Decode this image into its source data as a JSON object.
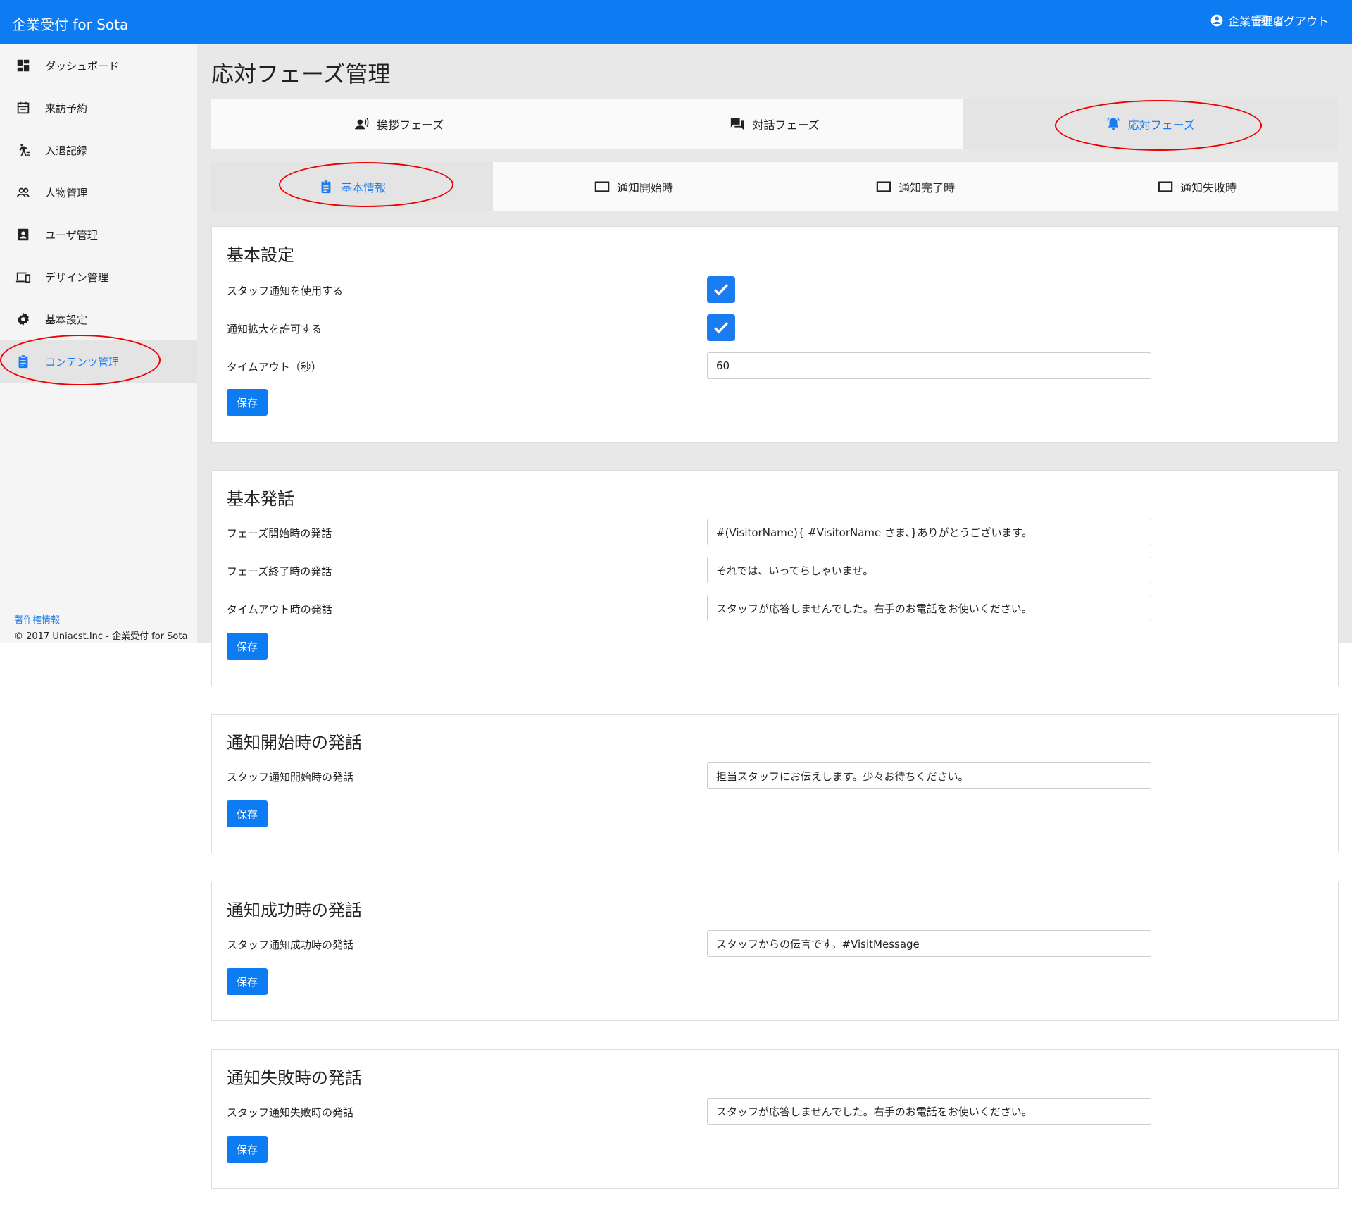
{
  "header": {
    "brand": "企業受付 for Sota",
    "user_label": "企業管理者",
    "logout_label": "ログアウト"
  },
  "sidebar": {
    "items": [
      {
        "label": "ダッシュボード",
        "icon": "dashboard-icon"
      },
      {
        "label": "来訪予約",
        "icon": "calendar-icon"
      },
      {
        "label": "入退記録",
        "icon": "walking-person-icon"
      },
      {
        "label": "人物管理",
        "icon": "people-icon"
      },
      {
        "label": "ユーザ管理",
        "icon": "contact-card-icon"
      },
      {
        "label": "デザイン管理",
        "icon": "devices-icon"
      },
      {
        "label": "基本設定",
        "icon": "gear-icon"
      },
      {
        "label": "コンテンツ管理",
        "icon": "clipboard-icon",
        "active": true
      }
    ],
    "footer_link": "著作権情報",
    "copyright": "© 2017 Uniacst.Inc - 企業受付 for Sota"
  },
  "page": {
    "title": "応対フェーズ管理"
  },
  "phase_tabs": [
    {
      "label": "挨拶フェーズ",
      "icon": "voice-person-icon"
    },
    {
      "label": "対話フェーズ",
      "icon": "chat-bubbles-icon"
    },
    {
      "label": "応対フェーズ",
      "icon": "bell-ringing-icon",
      "active": true
    }
  ],
  "sub_tabs": [
    {
      "label": "基本情報",
      "icon": "clipboard-icon",
      "active": true
    },
    {
      "label": "通知開始時",
      "icon": "tablet-icon"
    },
    {
      "label": "通知完了時",
      "icon": "tablet-icon"
    },
    {
      "label": "通知失敗時",
      "icon": "tablet-icon"
    }
  ],
  "panels": {
    "basic_settings": {
      "title": "基本設定",
      "staff_notify_label": "スタッフ通知を使用する",
      "staff_notify_checked": true,
      "notify_expand_label": "通知拡大を許可する",
      "notify_expand_checked": true,
      "timeout_label": "タイムアウト（秒）",
      "timeout_value": "60",
      "save_label": "保存"
    },
    "basic_speech": {
      "title": "基本発話",
      "start_label": "フェーズ開始時の発話",
      "start_value": "#(VisitorName){ #VisitorName さま、}ありがとうございます。",
      "end_label": "フェーズ終了時の発話",
      "end_value": "それでは、いってらしゃいませ。",
      "timeout_label": "タイムアウト時の発話",
      "timeout_value": "スタッフが応答しませんでした。右手のお電話をお使いください。",
      "save_label": "保存"
    },
    "notify_start": {
      "title": "通知開始時の発話",
      "label": "スタッフ通知開始時の発話",
      "value": "担当スタッフにお伝えします。少々お待ちください。",
      "save_label": "保存"
    },
    "notify_success": {
      "title": "通知成功時の発話",
      "label": "スタッフ通知成功時の発話",
      "value": "スタッフからの伝言です。#VisitMessage",
      "save_label": "保存"
    },
    "notify_fail": {
      "title": "通知失敗時の発話",
      "label": "スタッフ通知失敗時の発話",
      "value": "スタッフが応答しませんでした。右手のお電話をお使いください。",
      "save_label": "保存"
    }
  },
  "colors": {
    "primary": "#0d7cf2",
    "active_text": "#1a7cf0",
    "annotation": "#ee0000"
  }
}
